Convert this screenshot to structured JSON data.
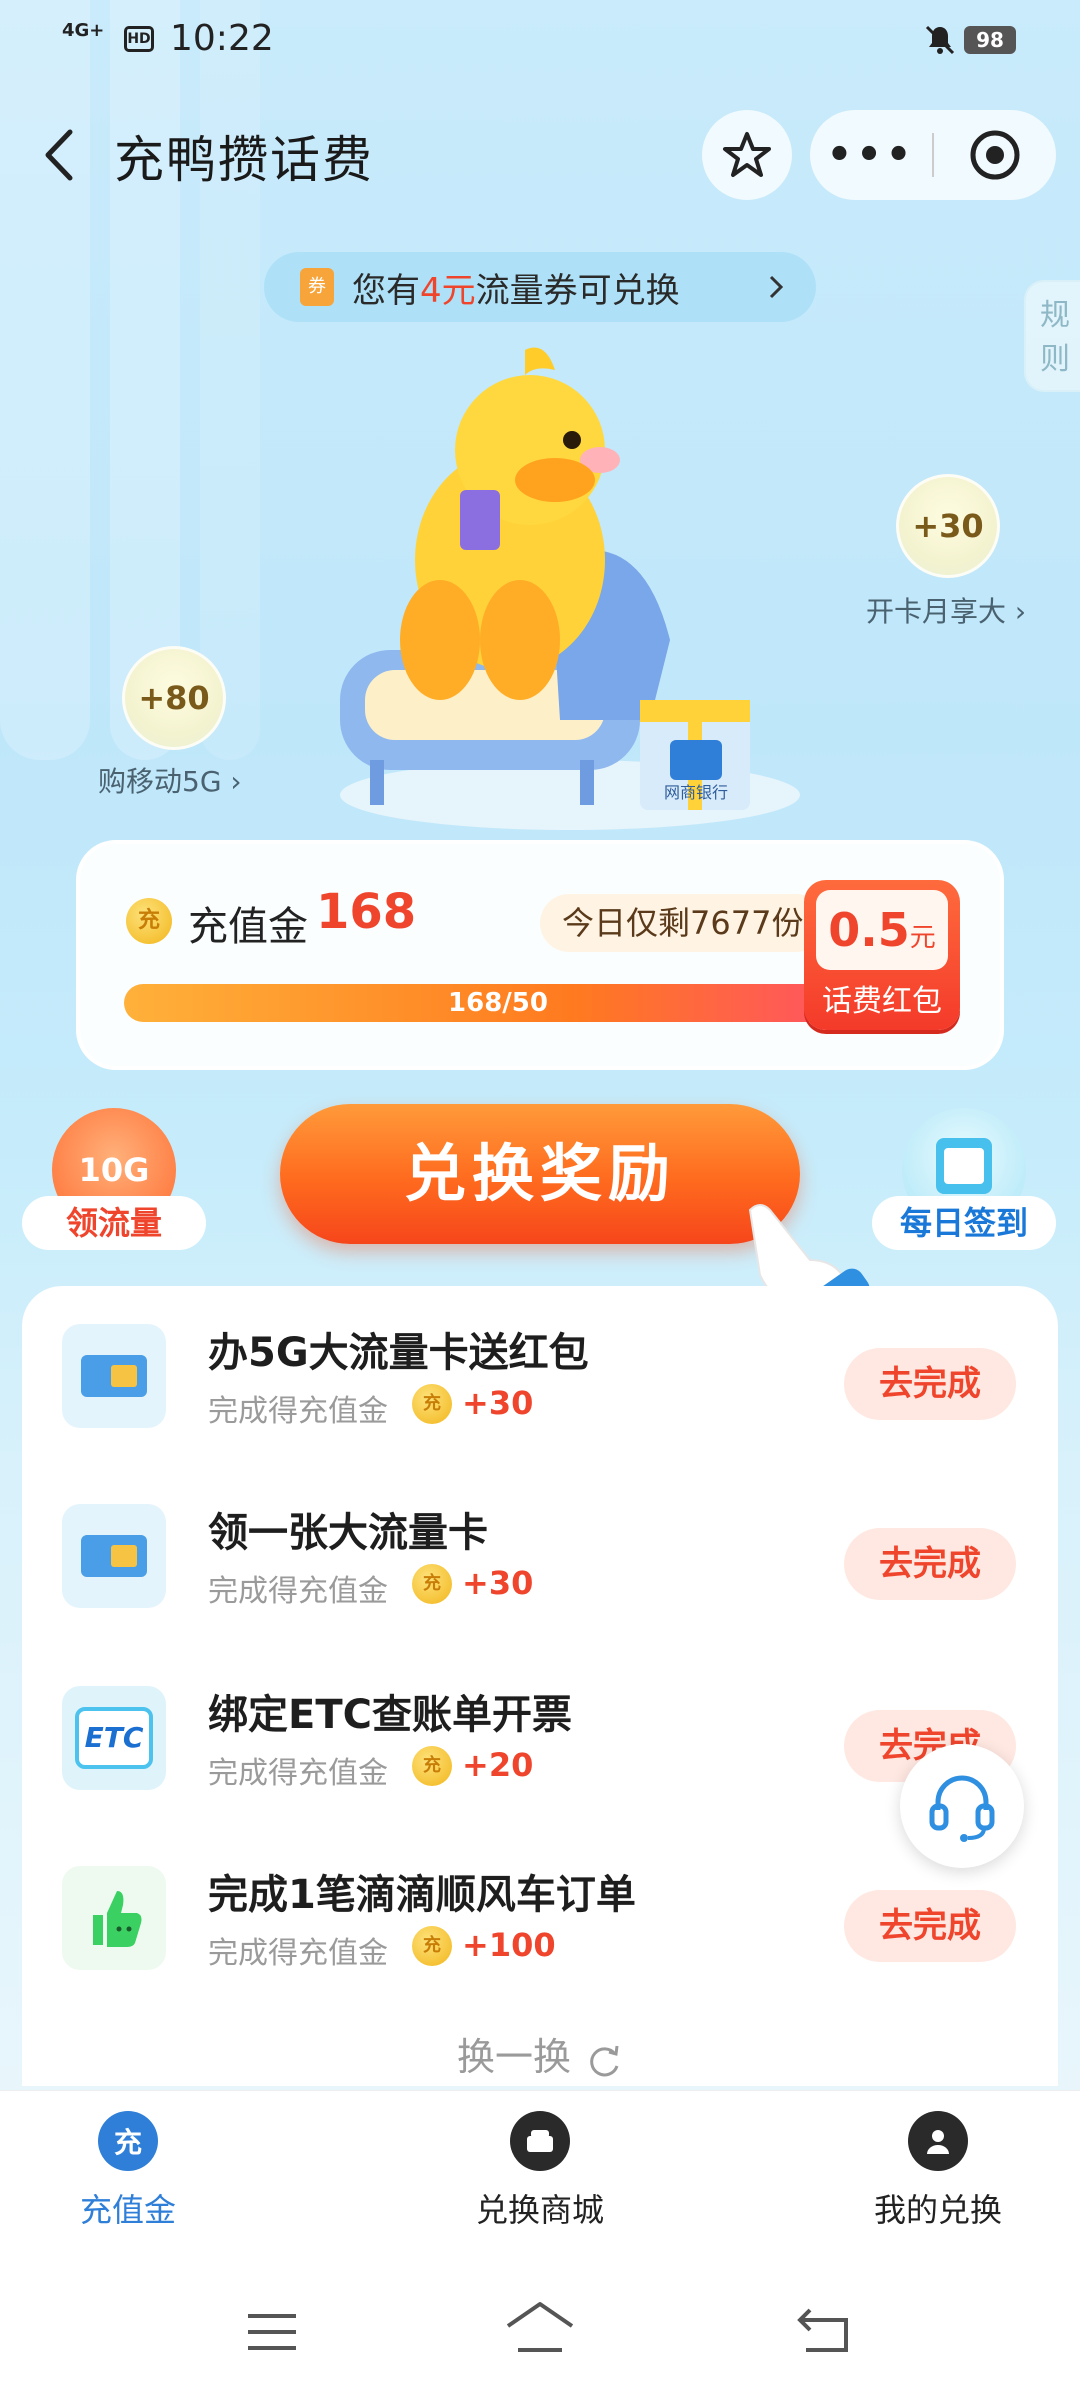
{
  "status_bar": {
    "time": "10:22",
    "network": "4G+",
    "hd": "HD",
    "battery": "98"
  },
  "header": {
    "title": "充鸭攒话费"
  },
  "coupon_banner": {
    "icon_text": "券",
    "prefix": "您有",
    "amount": "4元",
    "suffix": "流量券可兑换"
  },
  "rules_tab": {
    "label": "规则"
  },
  "bubbles": [
    {
      "value": "+30",
      "caption": "开卡月享大",
      "arrow": "›"
    },
    {
      "value": "+80",
      "caption": "购移动5G",
      "arrow": "›"
    }
  ],
  "mascot": {
    "gift_label": "网商银行"
  },
  "balance_card": {
    "coin_text": "充",
    "label": "充值金",
    "value": "168",
    "remaining": "今日仅剩7677份",
    "progress_text": "168/50",
    "progress_fraction": 1.0,
    "red_packet": {
      "amount": "0.5",
      "unit": "元",
      "label": "话费红包"
    }
  },
  "actions": {
    "flow_badge": "10G",
    "flow_label": "领流量",
    "exchange_label": "兑换奖励",
    "signin_label": "每日签到"
  },
  "tasks": [
    {
      "name": "办5G大流量卡送红包",
      "sub": "完成得充值金",
      "coin": "充",
      "reward": "+30",
      "button": "去完成",
      "icon": "sim-card-icon"
    },
    {
      "name": "领一张大流量卡",
      "sub": "完成得充值金",
      "coin": "充",
      "reward": "+30",
      "button": "去完成",
      "icon": "sim-card-icon"
    },
    {
      "name": "绑定ETC查账单开票",
      "sub": "完成得充值金",
      "coin": "充",
      "reward": "+20",
      "button": "去完成",
      "icon": "etc-icon",
      "icon_text": "ETC"
    },
    {
      "name": "完成1笔滴滴顺风车订单",
      "sub": "完成得充值金",
      "coin": "充",
      "reward": "+100",
      "button": "去完成",
      "icon": "thumbs-up-icon"
    }
  ],
  "swap_label": "换一换",
  "tabbar": {
    "items": [
      {
        "label": "充值金",
        "icon_text": "充",
        "active": true
      },
      {
        "label": "兑换商城",
        "active": false
      },
      {
        "label": "我的兑换",
        "active": false
      }
    ]
  },
  "colors": {
    "accent": "#f0452d",
    "active_tab": "#2f7fd8",
    "orange": "#ff7a1f"
  }
}
